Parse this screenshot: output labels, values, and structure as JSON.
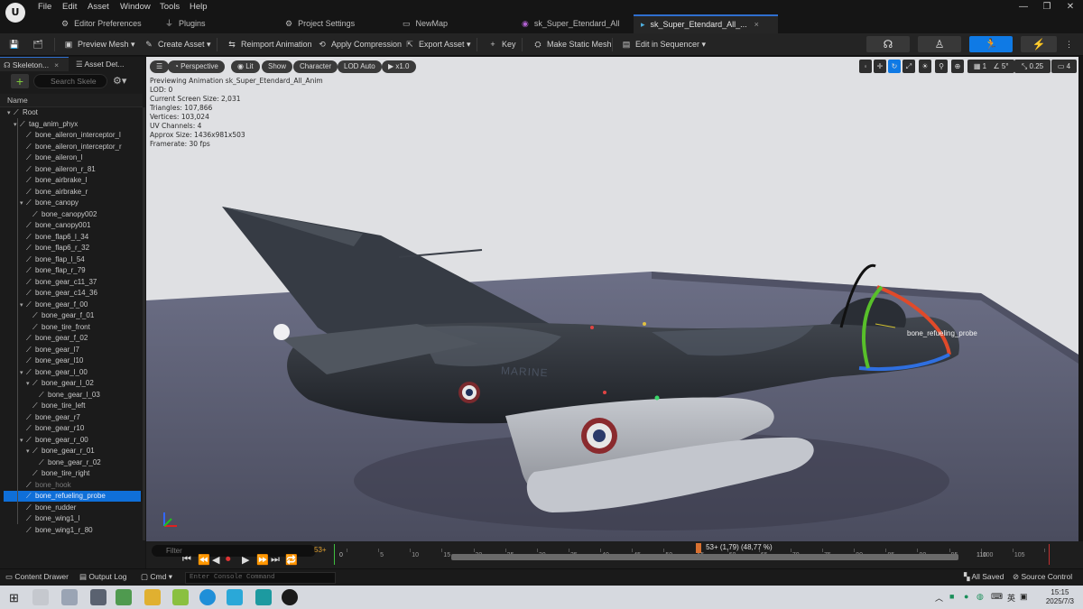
{
  "menu": {
    "logo": "U",
    "items": [
      "File",
      "Edit",
      "Asset",
      "Window",
      "Tools",
      "Help"
    ]
  },
  "tabs": [
    {
      "label": "Editor Preferences",
      "icon": "gear-icon"
    },
    {
      "label": "Plugins",
      "icon": "plug-icon"
    },
    {
      "label": "Project Settings",
      "icon": "gear-icon"
    },
    {
      "label": "NewMap",
      "icon": "level-icon"
    },
    {
      "label": "sk_Super_Etendard_All",
      "icon": "skeleton-asset-icon"
    },
    {
      "label": "sk_Super_Etendard_All_...",
      "icon": "animation-asset-icon"
    }
  ],
  "tab_close": "×",
  "toolbar": {
    "preview_mesh": "Preview Mesh",
    "create_asset": "Create Asset",
    "reimport": "Reimport Animation",
    "apply_compression": "Apply Compression",
    "export_asset": "Export Asset",
    "key": "Key",
    "make_static_mesh": "Make Static Mesh",
    "edit_in_sequencer": "Edit in Sequencer"
  },
  "left_panel": {
    "tab_skeleton": "Skeleton...",
    "tab_asset_details": "Asset Det...",
    "search_placeholder": "Search Skele",
    "column_name": "Name",
    "bones": [
      {
        "label": "Root",
        "depth": 0
      },
      {
        "label": "tag_anim_phyx",
        "depth": 1
      },
      {
        "label": "bone_aileron_interceptor_l",
        "depth": 2
      },
      {
        "label": "bone_aileron_interceptor_r",
        "depth": 2
      },
      {
        "label": "bone_aileron_l",
        "depth": 2
      },
      {
        "label": "bone_aileron_r_81",
        "depth": 2
      },
      {
        "label": "bone_airbrake_l",
        "depth": 2
      },
      {
        "label": "bone_airbrake_r",
        "depth": 2
      },
      {
        "label": "bone_canopy",
        "depth": 2
      },
      {
        "label": "bone_canopy002",
        "depth": 3
      },
      {
        "label": "bone_canopy001",
        "depth": 2
      },
      {
        "label": "bone_flap6_l_34",
        "depth": 2
      },
      {
        "label": "bone_flap6_r_32",
        "depth": 2
      },
      {
        "label": "bone_flap_l_54",
        "depth": 2
      },
      {
        "label": "bone_flap_r_79",
        "depth": 2
      },
      {
        "label": "bone_gear_c11_37",
        "depth": 2
      },
      {
        "label": "bone_gear_c14_36",
        "depth": 2
      },
      {
        "label": "bone_gear_f_00",
        "depth": 2
      },
      {
        "label": "bone_gear_f_01",
        "depth": 3
      },
      {
        "label": "bone_tire_front",
        "depth": 3
      },
      {
        "label": "bone_gear_f_02",
        "depth": 2
      },
      {
        "label": "bone_gear_l7",
        "depth": 2
      },
      {
        "label": "bone_gear_l10",
        "depth": 2
      },
      {
        "label": "bone_gear_l_00",
        "depth": 2
      },
      {
        "label": "bone_gear_l_02",
        "depth": 3
      },
      {
        "label": "bone_gear_l_03",
        "depth": 4
      },
      {
        "label": "bone_tire_left",
        "depth": 3
      },
      {
        "label": "bone_gear_r7",
        "depth": 2
      },
      {
        "label": "bone_gear_r10",
        "depth": 2
      },
      {
        "label": "bone_gear_r_00",
        "depth": 2
      },
      {
        "label": "bone_gear_r_01",
        "depth": 3
      },
      {
        "label": "bone_gear_r_02",
        "depth": 4
      },
      {
        "label": "bone_tire_right",
        "depth": 3
      },
      {
        "label": "bone_hook",
        "depth": 2,
        "dim": true
      },
      {
        "label": "bone_refueling_probe",
        "depth": 2,
        "selected": true
      },
      {
        "label": "bone_rudder",
        "depth": 2
      },
      {
        "label": "bone_wing1_l",
        "depth": 2
      },
      {
        "label": "bone_wing1_r_80",
        "depth": 2
      }
    ]
  },
  "viewport": {
    "perspective": "Perspective",
    "lit": "Lit",
    "show": "Show",
    "character": "Character",
    "lod": "LOD Auto",
    "speed": "x1.0",
    "grid_size": "1",
    "angle_snap": "5°",
    "scale_snap": "0.25",
    "camera_speed": "4",
    "info": [
      "Previewing Animation sk_Super_Etendard_All_Anim",
      "LOD: 0",
      "Current Screen Size: 2,031",
      "Triangles: 107,866",
      "Vertices: 103,024",
      "UV Channels: 4",
      "Approx Size: 1436x981x503",
      "Framerate: 30 fps"
    ],
    "bone_label": "bone_refueling_probe",
    "fuselage_text": "MARINE"
  },
  "timeline": {
    "filter_placeholder": "Filter",
    "current_frame": "53+",
    "frame_info": "53+ (1,79) (48,77 %)",
    "ticks": [
      "0",
      "5",
      "10",
      "15",
      "20",
      "25",
      "30",
      "35",
      "40",
      "45",
      "50",
      "55",
      "60",
      "65",
      "70",
      "75",
      "80",
      "85",
      "90",
      "95",
      "100",
      "105",
      "110"
    ],
    "start_frame": "0",
    "end_frame": "110",
    "playhead_fraction": 0.4877
  },
  "status": {
    "content_drawer": "Content Drawer",
    "output_log": "Output Log",
    "cmd": "Cmd",
    "console_placeholder": "Enter Console Command",
    "all_saved": "All Saved",
    "source_control": "Source Control"
  },
  "taskbar": {
    "time": "15:15",
    "date": "2025/7/3",
    "ime": "英"
  }
}
